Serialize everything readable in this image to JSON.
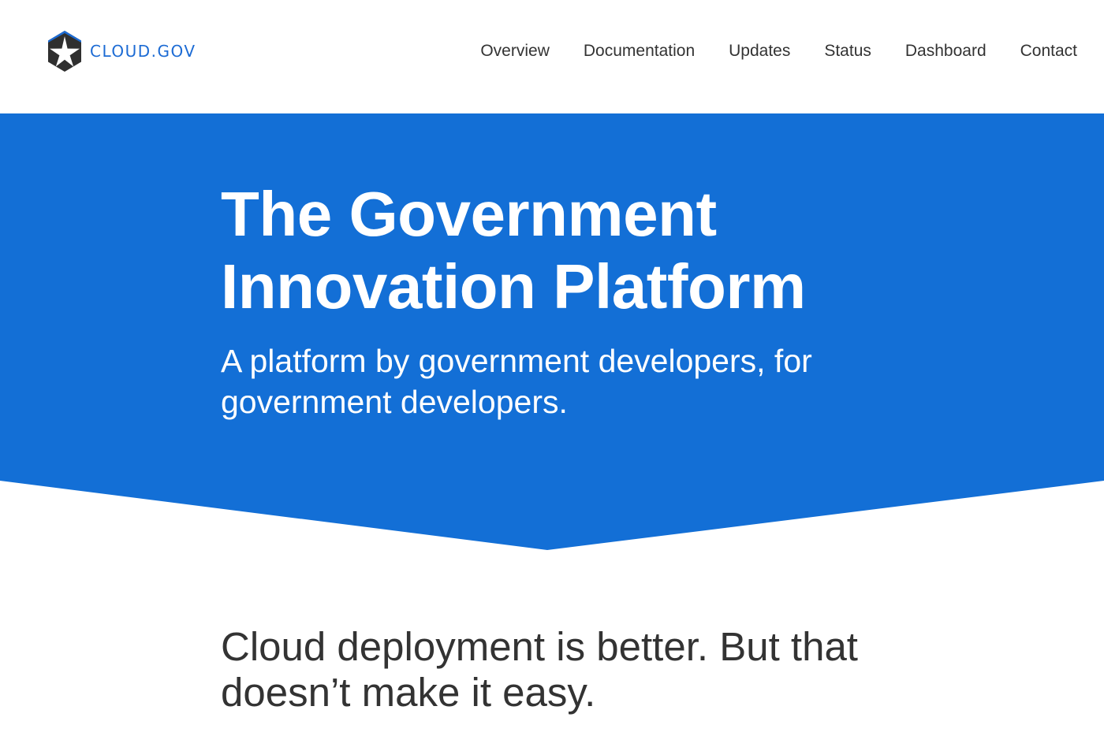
{
  "colors": {
    "brand_blue": "#1c6bd4",
    "hero_blue": "#136fd6",
    "text_dark": "#333333",
    "logo_hex": "#2f2f2f"
  },
  "header": {
    "logo": {
      "icon": "hexagon-star-icon",
      "text": "CLOUD.GOV"
    },
    "nav": [
      {
        "label": "Overview"
      },
      {
        "label": "Documentation"
      },
      {
        "label": "Updates"
      },
      {
        "label": "Status"
      },
      {
        "label": "Dashboard"
      },
      {
        "label": "Contact"
      }
    ]
  },
  "hero": {
    "title": "The Government Innovation Platform",
    "subtitle": "A platform by government developers, for government developers."
  },
  "main": {
    "heading": "Cloud deployment is better. But that doesn’t make it easy."
  }
}
